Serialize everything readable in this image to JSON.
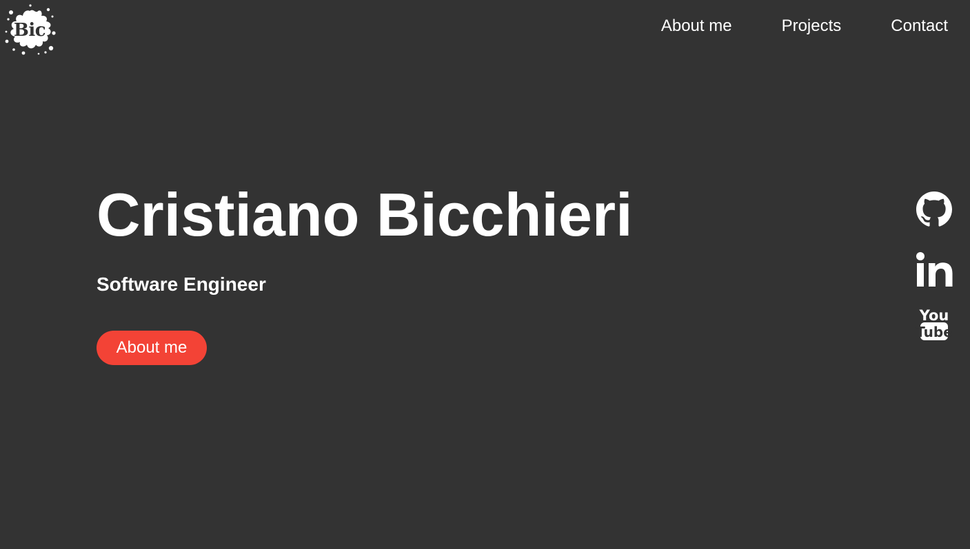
{
  "logo": {
    "text": "Bic"
  },
  "nav": {
    "items": [
      {
        "label": "About me"
      },
      {
        "label": "Projects"
      },
      {
        "label": "Contact"
      }
    ]
  },
  "hero": {
    "title": "Cristiano Bicchieri",
    "subtitle": "Software Engineer",
    "button_label": "About me"
  },
  "social": {
    "links": [
      {
        "icon": "github-icon"
      },
      {
        "icon": "linkedin-icon"
      },
      {
        "icon": "youtube-icon",
        "text_top": "You",
        "text_bottom": "Tube"
      }
    ]
  },
  "colors": {
    "background": "#333333",
    "text": "#ffffff",
    "accent": "#f34336"
  }
}
